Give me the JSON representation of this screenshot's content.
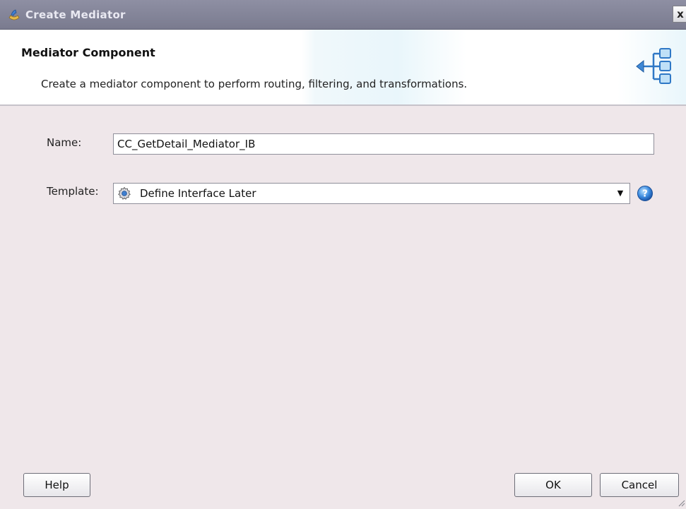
{
  "window": {
    "title": "Create Mediator",
    "close_label": "x"
  },
  "header": {
    "title": "Mediator Component",
    "description": "Create a mediator component to perform routing, filtering, and transformations."
  },
  "form": {
    "name_label": "Name:",
    "name_value": "CC_GetDetail_Mediator_IB",
    "template_label": "Template:",
    "template_value": "Define Interface Later"
  },
  "buttons": {
    "help": "Help",
    "ok": "OK",
    "cancel": "Cancel"
  },
  "icons": {
    "title": "mediator-app-icon",
    "header": "mediator-routing-icon",
    "template": "gear-icon",
    "help": "help-icon"
  },
  "colors": {
    "titlebar": "#7a7b8f",
    "body_bg": "#efe7ea",
    "accent_blue": "#2f78c6"
  }
}
